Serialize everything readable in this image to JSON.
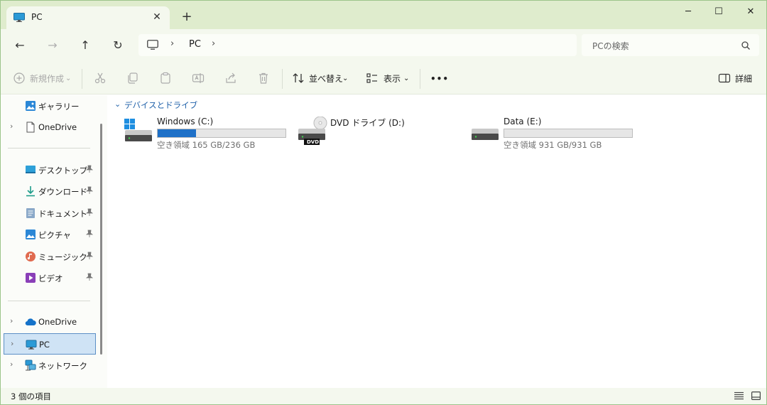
{
  "window": {
    "tab_title": "PC",
    "close_glyph": "✕",
    "new_tab_glyph": "+",
    "controls": [
      "─",
      "☐",
      "✕"
    ]
  },
  "nav": {
    "back": "←",
    "forward": "→",
    "up": "↑",
    "refresh": "↻",
    "address_path": [
      "PC"
    ],
    "separator": "›",
    "search_placeholder": "PCの検索"
  },
  "toolbar": {
    "new_label": "新規作成",
    "sort_label": "並べ替え",
    "view_label": "表示",
    "more_label": "•••",
    "details_label": "詳細",
    "chevron": "⌄"
  },
  "sidebar": {
    "chevron": "›",
    "top": [
      {
        "label": "ギャラリー",
        "icon": "gallery-icon",
        "expandable": false
      },
      {
        "label": "OneDrive",
        "icon": "onedrive-file-icon",
        "expandable": true
      }
    ],
    "pinned": [
      {
        "label": "デスクトップ",
        "icon": "desktop-icon"
      },
      {
        "label": "ダウンロード",
        "icon": "download-icon"
      },
      {
        "label": "ドキュメント",
        "icon": "documents-icon"
      },
      {
        "label": "ピクチャ",
        "icon": "pictures-icon"
      },
      {
        "label": "ミュージック",
        "icon": "music-icon"
      },
      {
        "label": "ビデオ",
        "icon": "video-icon"
      }
    ],
    "bottom": [
      {
        "label": "OneDrive",
        "icon": "onedrive-cloud-icon",
        "selected": false
      },
      {
        "label": "PC",
        "icon": "pc-icon",
        "selected": true
      },
      {
        "label": "ネットワーク",
        "icon": "network-icon",
        "selected": false
      }
    ]
  },
  "main": {
    "group_title": "デバイスとドライブ",
    "group_chevron": "⌄",
    "drives": [
      {
        "name": "Windows (C:)",
        "free_text": "空き領域 165 GB/236 GB",
        "used_fraction": 0.3,
        "icon": "windows-drive-icon"
      },
      {
        "name": "DVD ドライブ (D:)",
        "free_text": "",
        "used_fraction": null,
        "icon": "dvd-drive-icon",
        "badge": "DVD"
      },
      {
        "name": "Data (E:)",
        "free_text": "空き領域 931 GB/931 GB",
        "used_fraction": 0.0,
        "icon": "hard-drive-icon"
      }
    ]
  },
  "status": {
    "item_count": "3 個の項目"
  },
  "colors": {
    "accent": "#1f71c8",
    "title_bg": "#dfeccd",
    "pane_bg": "#f4f8ee",
    "selected_bg": "#cfe3f5"
  }
}
